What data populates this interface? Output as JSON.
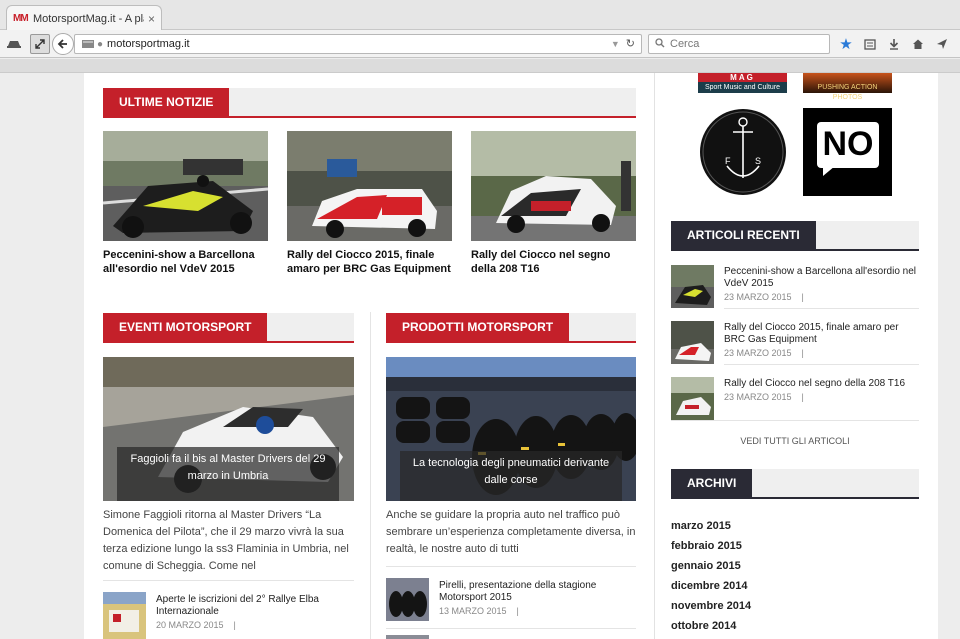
{
  "browser": {
    "tab_title": "MotorsportMag.it - A place ...",
    "tab_close": "×",
    "favicon_text": "MM",
    "url": "motorsportmag.it",
    "search_placeholder": "Cerca"
  },
  "news": {
    "heading": "ULTIME NOTIZIE",
    "items": [
      {
        "title": "Peccenini-show a Barcellona all'esordio nel VdeV 2015"
      },
      {
        "title": "Rally del Ciocco 2015, finale amaro per BRC Gas Equipment"
      },
      {
        "title": "Rally del Ciocco nel segno della 208 T16"
      }
    ]
  },
  "events": {
    "heading": "EVENTI MOTORSPORT",
    "feature_title": "Faggioli fa il bis al Master Drivers del 29 marzo in Umbria",
    "excerpt": "Simone Faggioli ritorna al Master Drivers “La Domenica del Pilota”, che il 29 marzo vivrà la sua terza edizione lungo la ss3 Flaminia in Umbria, nel comune di Scheggia. Come nel",
    "list": [
      {
        "title": "Aperte le iscrizioni del 2° Rallye Elba Internazionale",
        "date": "20 MARZO 2015",
        "sep": "|"
      }
    ]
  },
  "products": {
    "heading": "PRODOTTI MOTORSPORT",
    "feature_title": "La tecnologia degli pneumatici derivante dalle corse",
    "excerpt": "Anche se guidare la propria auto nel traffico può sembrare un’esperienza completamente diversa, in realtà, le nostre auto di tutti",
    "list": [
      {
        "title": "Pirelli, presentazione della stagione Motorsport 2015",
        "date": "13 MARZO 2015",
        "sep": "|"
      }
    ]
  },
  "sidebar": {
    "ad_top_left": "Sport Music and Culture",
    "ad_top_left_brand": "MAG",
    "ad_top_right": "PUSHING ACTION PHOTOS",
    "logo_no": "NO",
    "logo_fs_left": "F",
    "logo_fs_right": "S",
    "recent_heading": "ARTICOLI RECENTI",
    "recent": [
      {
        "title": "Peccenini-show a Barcellona all'esordio nel VdeV 2015",
        "date": "23 MARZO 2015",
        "sep": "|"
      },
      {
        "title": "Rally del Ciocco 2015, finale amaro per BRC Gas Equipment",
        "date": "23 MARZO 2015",
        "sep": "|"
      },
      {
        "title": "Rally del Ciocco nel segno della 208 T16",
        "date": "23 MARZO 2015",
        "sep": "|"
      }
    ],
    "see_all": "VEDI TUTTI GLI ARTICOLI",
    "archive_heading": "ARCHIVI",
    "archives": [
      "marzo 2015",
      "febbraio 2015",
      "gennaio 2015",
      "dicembre 2014",
      "novembre 2014",
      "ottobre 2014"
    ]
  }
}
